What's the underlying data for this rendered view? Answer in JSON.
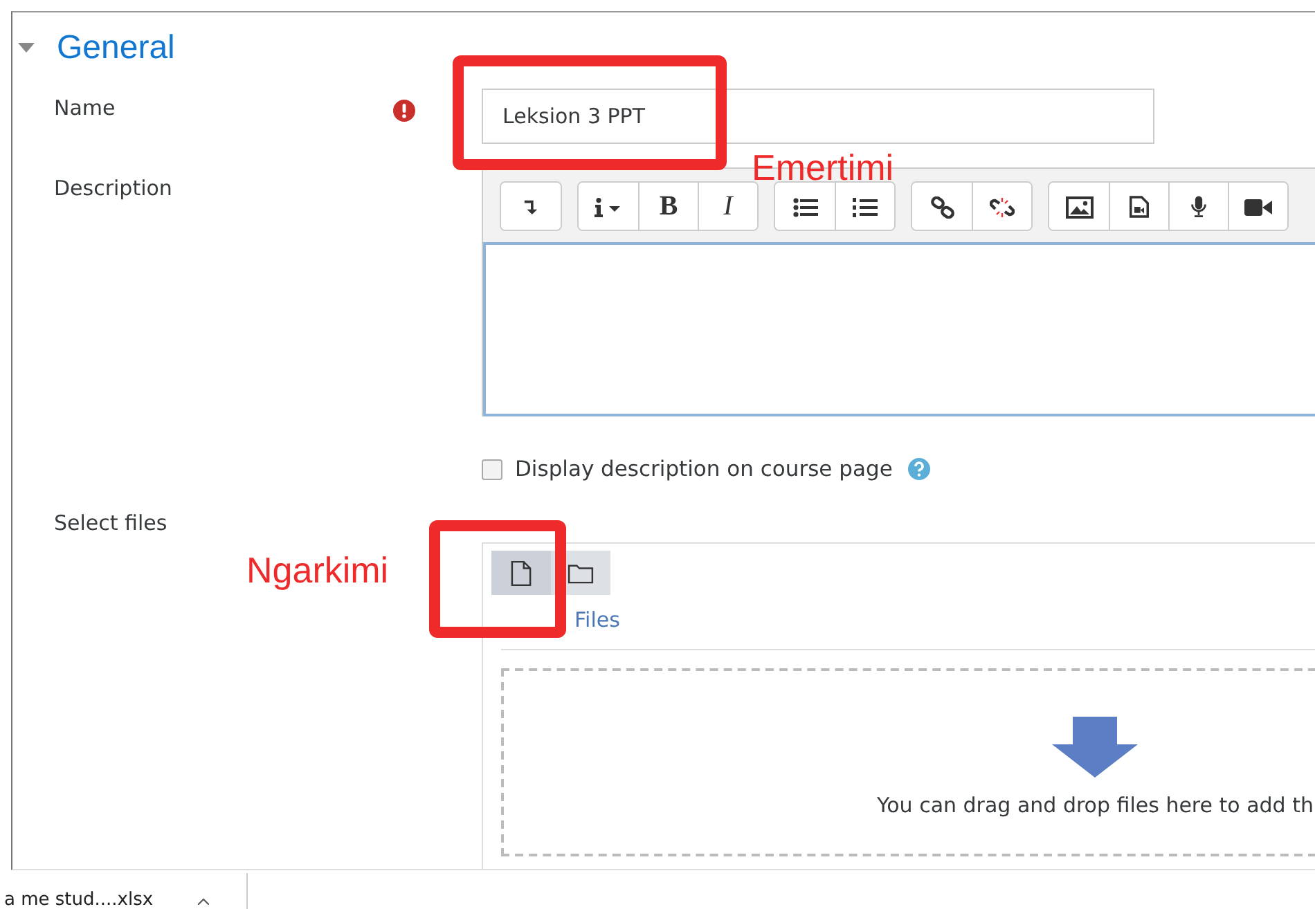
{
  "section": {
    "title": "General",
    "expanded": true
  },
  "name_field": {
    "label": "Name",
    "required": true,
    "value": "Leksion 3 PPT"
  },
  "description": {
    "label": "Description",
    "toolbar_groups": [
      [
        {
          "kind": "collapse"
        }
      ],
      [
        {
          "kind": "info-dropdown"
        },
        {
          "kind": "bold",
          "text": "B"
        },
        {
          "kind": "italic",
          "text": "I"
        }
      ],
      [
        {
          "kind": "bullet-list"
        },
        {
          "kind": "numbered-list"
        }
      ],
      [
        {
          "kind": "link"
        },
        {
          "kind": "unlink"
        }
      ],
      [
        {
          "kind": "image"
        },
        {
          "kind": "media"
        },
        {
          "kind": "microphone"
        },
        {
          "kind": "video"
        }
      ]
    ]
  },
  "display_description": {
    "label": "Display description on course page",
    "checked": false
  },
  "select_files": {
    "label": "Select files",
    "views": [
      {
        "kind": "file",
        "selected": true
      },
      {
        "kind": "folder",
        "selected": false
      }
    ],
    "path": "Files",
    "drop_text": "You can drag and drop files here to add th"
  },
  "annotations": [
    {
      "kind": "name",
      "text": "Emertimi"
    },
    {
      "kind": "upload",
      "text": "Ngarkimi"
    }
  ],
  "download_bar": {
    "file": "a me stud....xlsx"
  }
}
